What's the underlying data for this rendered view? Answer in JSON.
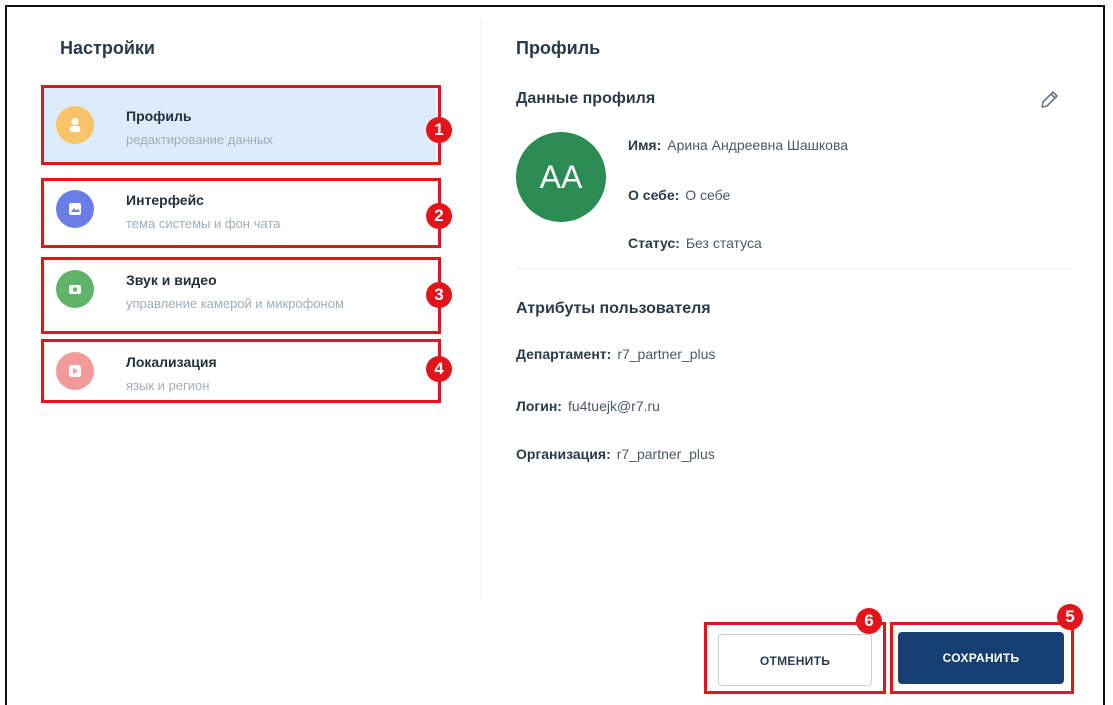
{
  "settings": {
    "title": "Настройки",
    "items": [
      {
        "title": "Профиль",
        "subtitle": "редактирование данных",
        "color": "#f8c469",
        "icon": "user-icon",
        "marker": "1"
      },
      {
        "title": "Интерфейс",
        "subtitle": "тема системы и фон чата",
        "color": "#6b7ee8",
        "icon": "image-icon",
        "marker": "2"
      },
      {
        "title": "Звук и видео",
        "subtitle": "управление камерой и микрофоном",
        "color": "#5fb36a",
        "icon": "camera-icon",
        "marker": "3"
      },
      {
        "title": "Локализация",
        "subtitle": "язык и регион",
        "color": "#f29a9a",
        "icon": "globe-icon",
        "marker": "4"
      }
    ]
  },
  "profile": {
    "title": "Профиль",
    "data_title": "Данные профиля",
    "avatar_initials": "АА",
    "avatar_color": "#2a8c52",
    "name_label": "Имя:",
    "name_value": "Арина Андреевна Шашкова",
    "about_label": "О себе:",
    "about_value": "О себе",
    "status_label": "Статус:",
    "status_value": "Без статуса",
    "attrs_title": "Атрибуты пользователя",
    "dept_label": "Департамент:",
    "dept_value": "r7_partner_plus",
    "login_label": "Логин:",
    "login_value": "fu4tuejk@r7.ru",
    "org_label": "Организация:",
    "org_value": "r7_partner_plus"
  },
  "actions": {
    "cancel_label": "ОТМЕНИТЬ",
    "save_label": "СОХРАНИТЬ",
    "cancel_marker": "6",
    "save_marker": "5"
  }
}
